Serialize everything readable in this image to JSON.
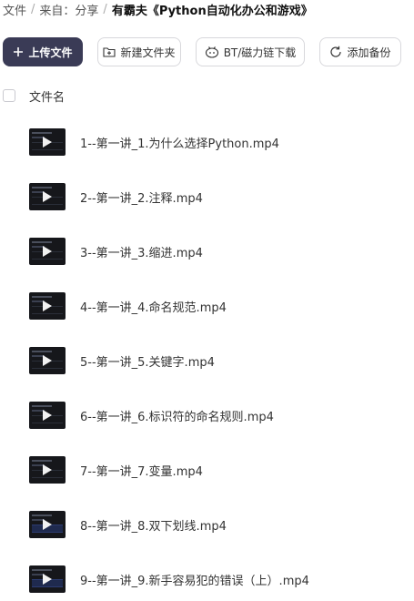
{
  "breadcrumb": {
    "items": [
      "文件",
      "来自：分享"
    ],
    "separator": "/",
    "current": "有霸夫《Python自动化办公和游戏》"
  },
  "toolbar": {
    "upload_label": "上传文件",
    "new_folder_label": "新建文件夹",
    "bt_label": "BT/磁力链下载",
    "backup_label": "添加备份"
  },
  "list_header": {
    "name_column": "文件名"
  },
  "files": [
    {
      "name": "1--第一讲_1.为什么选择Python.mp4"
    },
    {
      "name": "2--第一讲_2.注释.mp4"
    },
    {
      "name": "3--第一讲_3.缩进.mp4"
    },
    {
      "name": "4--第一讲_4.命名规范.mp4"
    },
    {
      "name": "5--第一讲_5.关键字.mp4"
    },
    {
      "name": "6--第一讲_6.标识符的命名规则.mp4"
    },
    {
      "name": "7--第一讲_7.变量.mp4"
    },
    {
      "name": "8--第一讲_8.双下划线.mp4"
    },
    {
      "name": "9--第一讲_9.新手容易犯的错误（上）.mp4"
    }
  ],
  "colors": {
    "primary_button": "#3a3b56",
    "thumbnail_bg": "#16171b"
  },
  "icons": {
    "upload": "plus-icon",
    "new_folder": "folder-plus-icon",
    "bt": "bt-icon",
    "backup": "sync-icon",
    "file_thumbnail": "video-thumbnail"
  }
}
